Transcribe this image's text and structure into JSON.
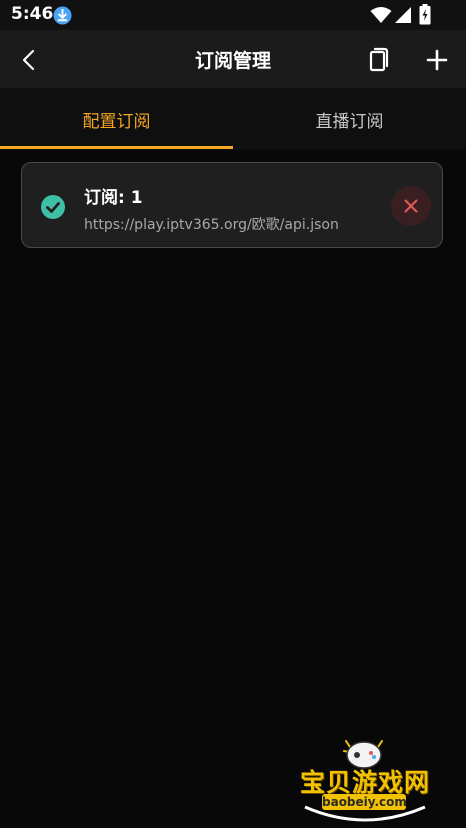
{
  "status_bar": {
    "time": "5:46",
    "icons": [
      "download-icon",
      "wifi-icon",
      "signal-icon",
      "battery-icon"
    ]
  },
  "app_bar": {
    "title": "订阅管理",
    "icons": [
      "back-arrow-icon",
      "copy-icon",
      "plus-icon"
    ]
  },
  "tabs": [
    {
      "label": "配置订阅",
      "active": true
    },
    {
      "label": "直播订阅",
      "active": false
    }
  ],
  "subscriptions": [
    {
      "name": "订阅: 1",
      "url": "https://play.iptv365.org/欧歌/api.json",
      "selected": true
    }
  ],
  "watermark": {
    "text": "宝贝游戏网",
    "domain": "baobeiy.com"
  },
  "colors": {
    "accent": "#f5a623",
    "check": "#3fbfa6",
    "delete": "#e05a5a",
    "background": "#080808",
    "card": "#1f1f1f"
  }
}
